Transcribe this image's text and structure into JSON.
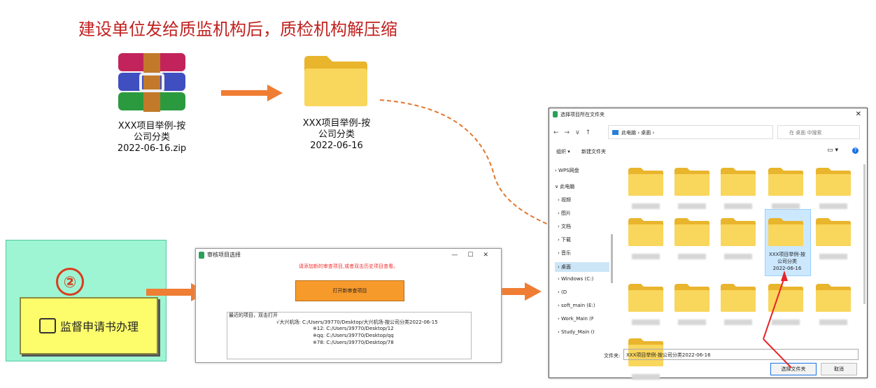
{
  "heading": "建设单位发给质监机构后，质检机构解压缩",
  "zip_caption": [
    "XXX项目举例-按",
    "公司分类",
    "2022-06-16.zip"
  ],
  "folder_caption": [
    "XXX项目举例-按",
    "公司分类",
    "2022-06-16"
  ],
  "step_number": "②",
  "step_button": "监督申请书办理",
  "window1": {
    "title": "审核项目选择",
    "message": "请添加新的审查项目,或者双击历史项目查看。",
    "open_button": "打开新审查项目",
    "recent_header": "最近的项目，双击打开",
    "recent_items": [
      "√大兴机场:  C:/Users/39770/Desktop/大兴机场-按公司分类2022-06-15",
      "※12:  C:/Users/39770/Desktop/12",
      "※qq:  C:/Users/39770/Desktop/qq",
      "※78:  C:/Users/39770/Desktop/78"
    ]
  },
  "dialog": {
    "title": "选择项目所在文件夹",
    "breadcrumb": "此电脑  ›  桌面  ›",
    "search_placeholder": "在 桌面 中搜索",
    "organize": "组织 ▾",
    "new_folder": "新建文件夹",
    "sidebar": [
      "›  WPS网盘",
      "∨  此电脑",
      "›  视频",
      "›  图片",
      "›  文档",
      "›  下载",
      "›  音乐",
      "›  桌面",
      "›  Windows (C:)",
      "›  (D",
      "›  soft_main (E:)",
      "›  Work_Main (F",
      "›  Study_Main (I"
    ],
    "selected_folder": [
      "XXX项目举例-按",
      "公司分类",
      "2022-06-16"
    ],
    "filename_label": "文件夹:",
    "filename_value": "XXX项目举例-按公司分类2022-06-16",
    "select_button": "选择文件夹",
    "cancel_button": "取消"
  },
  "colors": {
    "accent_red": "#c0211f",
    "arrow_orange": "#ef7d33",
    "folder_yellow": "#f8d154"
  }
}
